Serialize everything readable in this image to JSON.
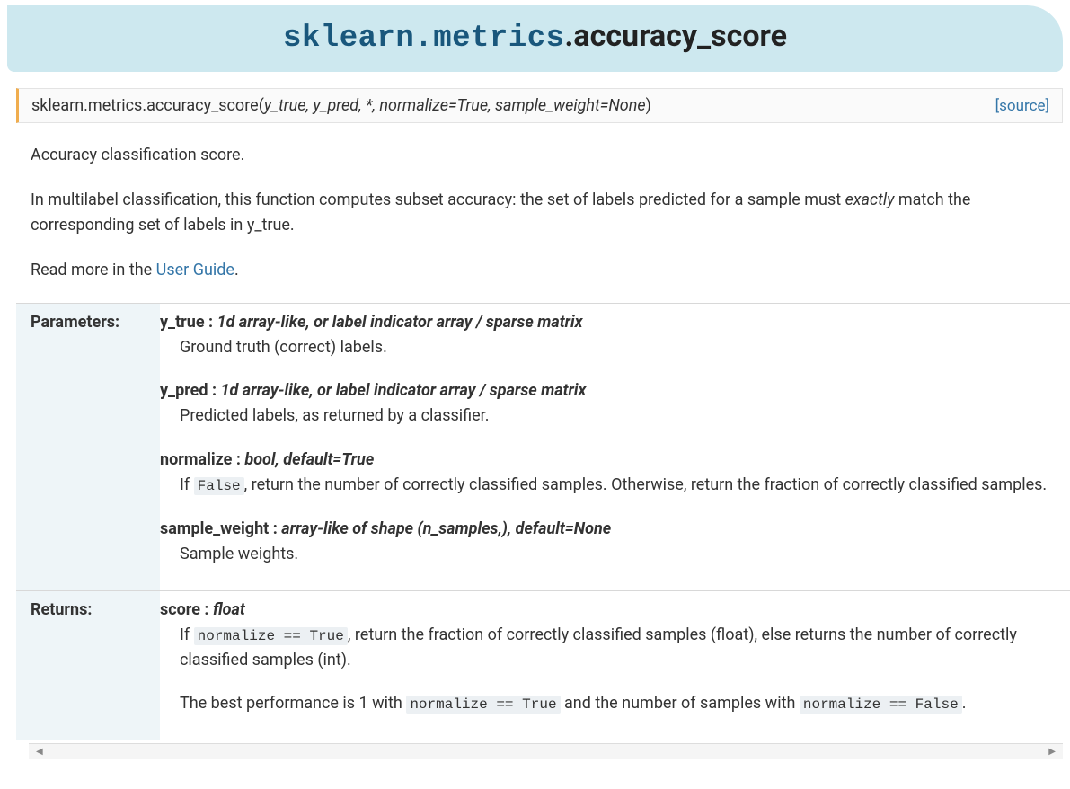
{
  "title": {
    "module": "sklearn.metrics",
    "name": "accuracy_score"
  },
  "signature": {
    "prefix": "sklearn.metrics.accuracy_score",
    "params_raw": "y_true, y_pred, *, normalize=True, sample_weight=None",
    "source_label": "[source]"
  },
  "description": {
    "p1": "Accuracy classification score.",
    "p2_a": "In multilabel classification, this function computes subset accuracy: the set of labels predicted for a sample must ",
    "p2_em": "exactly",
    "p2_b": " match the corresponding set of labels in y_true.",
    "p3_a": "Read more in the ",
    "p3_link": "User Guide",
    "p3_b": "."
  },
  "fields": {
    "parameters_label": "Parameters:",
    "returns_label": "Returns:",
    "parameters": [
      {
        "name": "y_true",
        "type": "1d array-like, or label indicator array / sparse matrix",
        "desc": "Ground truth (correct) labels."
      },
      {
        "name": "y_pred",
        "type": "1d array-like, or label indicator array / sparse matrix",
        "desc": "Predicted labels, as returned by a classifier."
      },
      {
        "name": "normalize",
        "type": "bool, default=True",
        "desc_pre": "If ",
        "desc_code": "False",
        "desc_post": ", return the number of correctly classified samples. Otherwise, return the fraction of correctly classified samples."
      },
      {
        "name": "sample_weight",
        "type": "array-like of shape (n_samples,), default=None",
        "desc": "Sample weights."
      }
    ],
    "returns": {
      "name": "score",
      "type": "float",
      "desc1_pre": "If ",
      "desc1_code": "normalize == True",
      "desc1_post": ", return the fraction of correctly classified samples (float), else returns the number of correctly classified samples (int).",
      "desc2_a": "The best performance is 1 with ",
      "desc2_code1": "normalize == True",
      "desc2_b": " and the number of samples with ",
      "desc2_code2": "normalize == False",
      "desc2_c": "."
    }
  }
}
